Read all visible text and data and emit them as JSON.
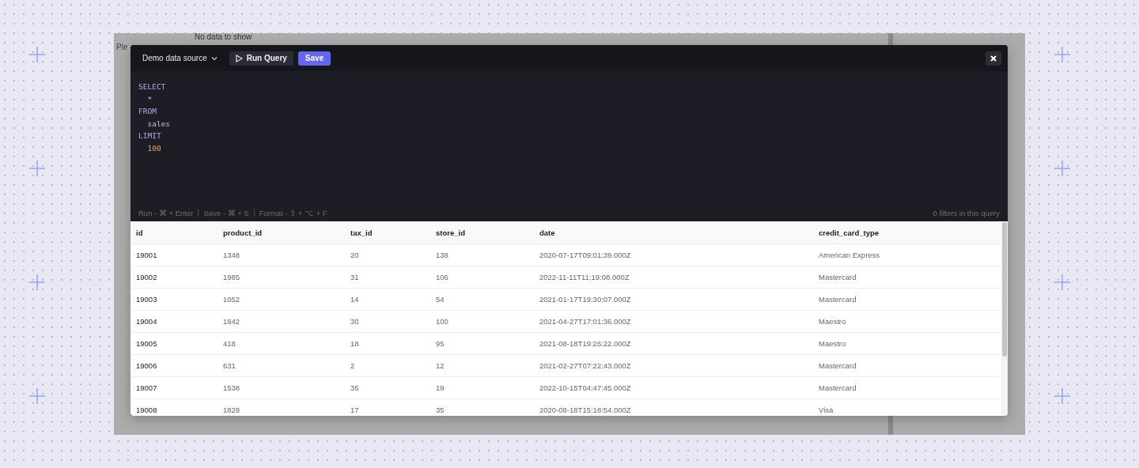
{
  "background_panel": {
    "empty_message": "No data to show",
    "hint": "Ple"
  },
  "toolbar": {
    "data_source": "Demo data source",
    "run_button": "Run Query",
    "save_button": "Save"
  },
  "editor": {
    "lines": [
      {
        "text": "SELECT",
        "kind": "keyword"
      },
      {
        "text": "  *",
        "kind": "plain"
      },
      {
        "text": "FROM",
        "kind": "keyword"
      },
      {
        "text": "  sales",
        "kind": "plain"
      },
      {
        "text": "LIMIT",
        "kind": "keyword"
      },
      {
        "text": "  100",
        "kind": "number"
      }
    ]
  },
  "shortcuts": [
    "Run - ⌘ + Enter",
    "Save - ⌘ + S",
    "Format - ⇧ + ⌥ + F"
  ],
  "filters_info": "0 filters in this query",
  "table": {
    "columns": [
      "id",
      "product_id",
      "tax_id",
      "store_id",
      "date",
      "credit_card_type"
    ],
    "rows": [
      [
        "19001",
        "1348",
        "20",
        "138",
        "2020-07-17T09:01:39.000Z",
        "American Express"
      ],
      [
        "19002",
        "1985",
        "31",
        "106",
        "2022-11-11T11:19:08.000Z",
        "Mastercard"
      ],
      [
        "19003",
        "1052",
        "14",
        "54",
        "2021-01-17T19:30:07.000Z",
        "Mastercard"
      ],
      [
        "19004",
        "1842",
        "30",
        "100",
        "2021-04-27T17:01:36.000Z",
        "Maestro"
      ],
      [
        "19005",
        "418",
        "18",
        "95",
        "2021-08-18T19:26:22.000Z",
        "Maestro"
      ],
      [
        "19006",
        "631",
        "2",
        "12",
        "2021-02-27T07:22:43.000Z",
        "Mastercard"
      ],
      [
        "19007",
        "1538",
        "35",
        "19",
        "2022-10-15T04:47:45.000Z",
        "Mastercard"
      ],
      [
        "19008",
        "1828",
        "17",
        "35",
        "2020-08-18T15:18:54.000Z",
        "Visa"
      ]
    ]
  }
}
